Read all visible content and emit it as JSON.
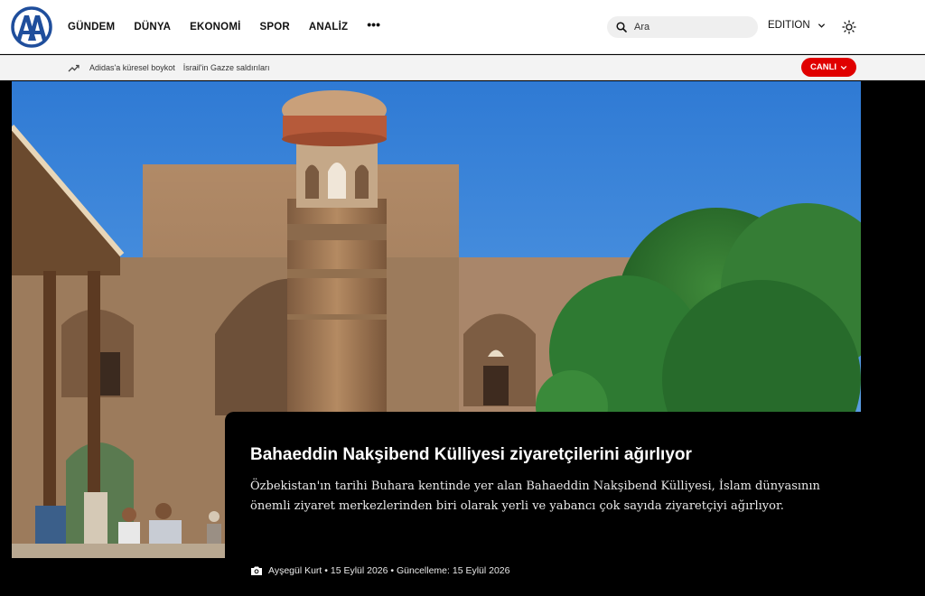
{
  "header": {
    "logo_text": "AA",
    "nav": [
      "GÜNDEM",
      "DÜNYA",
      "EKONOMİ",
      "SPOR",
      "ANALİZ"
    ],
    "more_label": "•••",
    "search_placeholder": "Ara",
    "edition_label": "EDITION",
    "icons": {
      "search": "search-icon",
      "edition": "chevron-down-icon",
      "theme": "sun-icon"
    }
  },
  "trending": {
    "icon": "trend-up-icon",
    "links": [
      "Adidas'a küresel boykot",
      "İsrail'in Gazze saldırıları"
    ],
    "live_label": "CANLI"
  },
  "article": {
    "title": "Bahaeddin Nakşibend Külliyesi ziyaretçilerini ağırlıyor",
    "summary": "Özbekistan'ın tarihi Buhara kentinde yer alan Bahaeddin Nakşibend Külliyesi, İslam dünyasının önemli ziyaret merkezlerinden biri olarak yerli ve yabancı çok sayıda ziyaretçiyi ağırlıyor.",
    "byline": "Ayşegül Kurt • 15 Eylül 2026 • Güncelleme: 15 Eylül 2026",
    "byline_icon": "camera-icon"
  },
  "colors": {
    "live_red": "#e00000",
    "brand_blue": "#1f4e9c"
  }
}
